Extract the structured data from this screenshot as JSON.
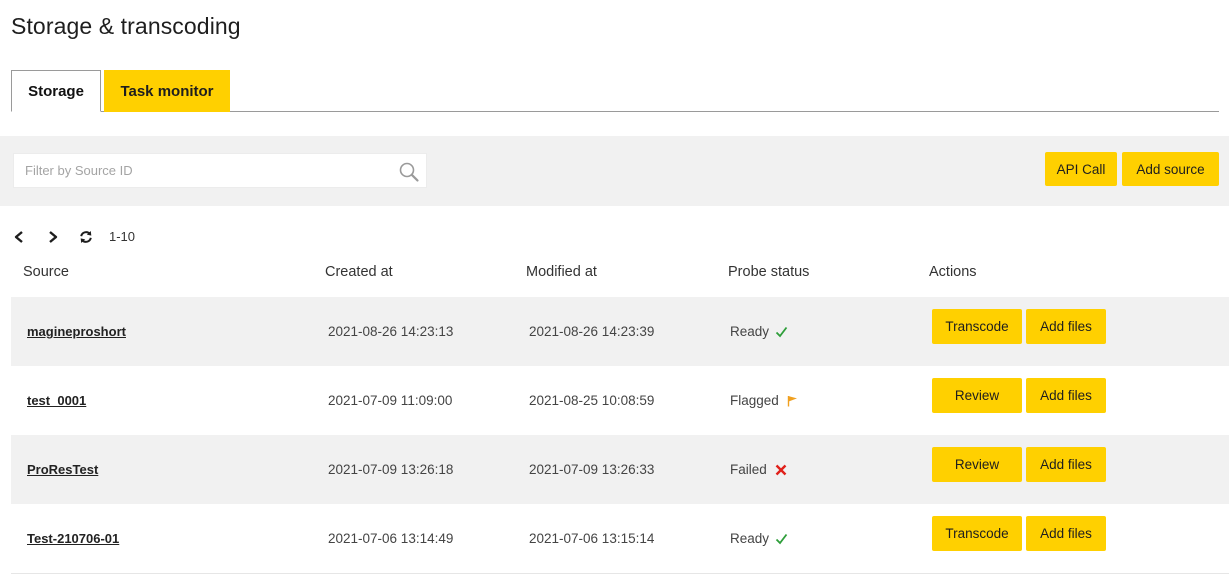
{
  "page": {
    "title": "Storage & transcoding"
  },
  "tabs": [
    {
      "label": "Storage",
      "active": true
    },
    {
      "label": "Task monitor",
      "active": false
    }
  ],
  "toolbar": {
    "filter_placeholder": "Filter by Source ID",
    "filter_value": "",
    "api_call_label": "API Call",
    "add_source_label": "Add source"
  },
  "pager": {
    "range": "1-10"
  },
  "table": {
    "headers": {
      "source": "Source",
      "created": "Created at",
      "modified": "Modified at",
      "status": "Probe status",
      "actions": "Actions"
    },
    "rows": [
      {
        "source": "magineproshort",
        "created": "2021-08-26 14:23:13",
        "modified": "2021-08-26 14:23:39",
        "status": "Ready",
        "status_icon": "check-icon",
        "primary_action": "Transcode",
        "secondary_action": "Add files"
      },
      {
        "source": "test_0001",
        "created": "2021-07-09 11:09:00",
        "modified": "2021-08-25 10:08:59",
        "status": "Flagged",
        "status_icon": "flag-icon",
        "primary_action": "Review",
        "secondary_action": "Add files"
      },
      {
        "source": "ProResTest",
        "created": "2021-07-09 13:26:18",
        "modified": "2021-07-09 13:26:33",
        "status": "Failed",
        "status_icon": "cross-icon",
        "primary_action": "Review",
        "secondary_action": "Add files"
      },
      {
        "source": "Test-210706-01",
        "created": "2021-07-06 13:14:49",
        "modified": "2021-07-06 13:15:14",
        "status": "Ready",
        "status_icon": "check-icon",
        "primary_action": "Transcode",
        "secondary_action": "Add files"
      }
    ]
  },
  "colors": {
    "accent": "#ffd000",
    "toolbar_bg": "#f1f1f1",
    "ready": "#2e9e3a",
    "flagged": "#f0a020",
    "failed": "#e0201a"
  }
}
